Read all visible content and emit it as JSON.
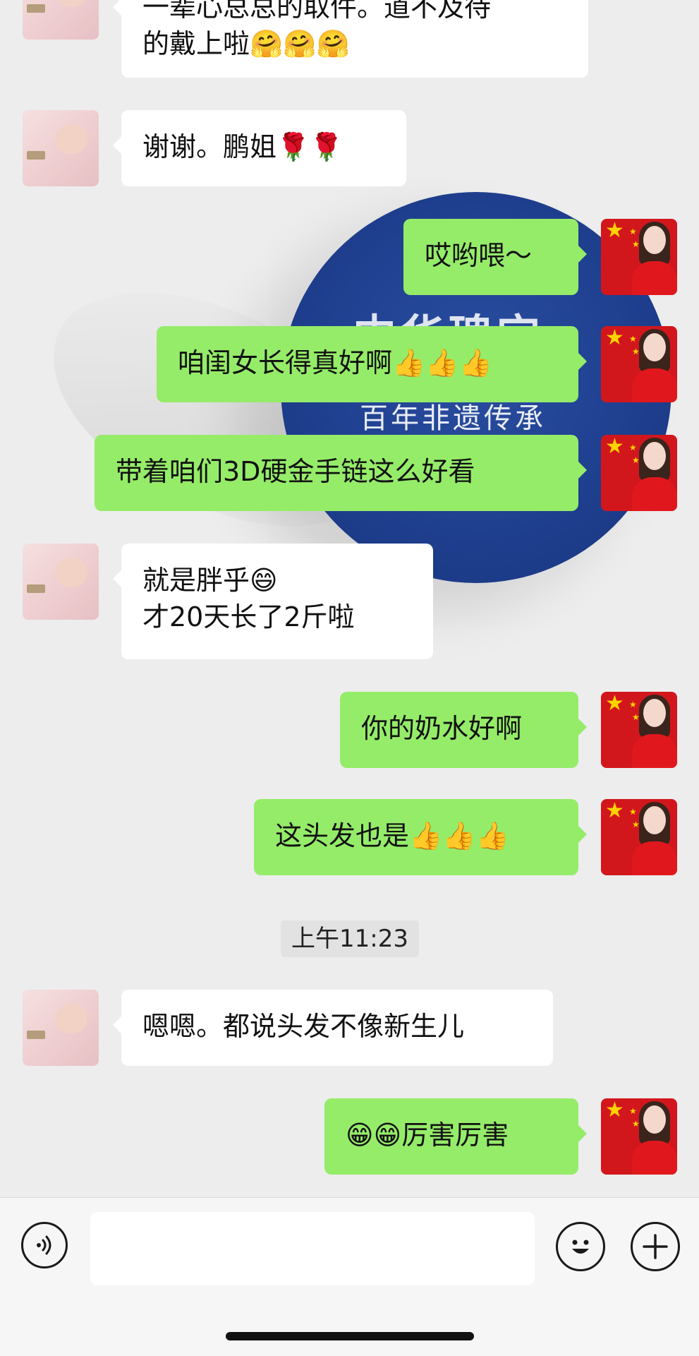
{
  "messages": [
    {
      "side": "in",
      "lines": [
        "一辈心总总的取件。道不及待",
        "的戴上啦🤗🤗🤗"
      ]
    },
    {
      "side": "in",
      "lines": [
        "谢谢。鹏姐🌹🌹"
      ]
    },
    {
      "side": "out",
      "lines": [
        "哎哟喂～"
      ]
    },
    {
      "side": "out",
      "lines": [
        "咱闺女长得真好啊👍👍👍"
      ]
    },
    {
      "side": "out",
      "lines": [
        "带着咱们3D硬金手链这么好看"
      ]
    },
    {
      "side": "in",
      "lines": [
        "就是胖乎😄",
        "才20天长了2斤啦"
      ]
    },
    {
      "side": "out",
      "lines": [
        "你的奶水好啊"
      ]
    },
    {
      "side": "out",
      "lines": [
        "这头发也是👍👍👍"
      ]
    },
    {
      "side": "in",
      "lines": [
        "嗯嗯。都说头发不像新生儿"
      ]
    },
    {
      "side": "out",
      "lines": [
        "😁😁厉害厉害"
      ]
    }
  ],
  "timestamp": "上午11:23",
  "background_art": {
    "line1": "中华瑰宝",
    "line2": "百年非遗传承",
    "circle_color": "#1f3f8f"
  },
  "input_bar": {
    "voice_icon": "voice-icon",
    "emoji_icon": "emoji-face-icon",
    "plus_icon": "plus-icon",
    "placeholder": ""
  },
  "colors": {
    "outgoing_bubble": "#95ec69",
    "incoming_bubble": "#ffffff",
    "chat_background": "#ededed"
  }
}
